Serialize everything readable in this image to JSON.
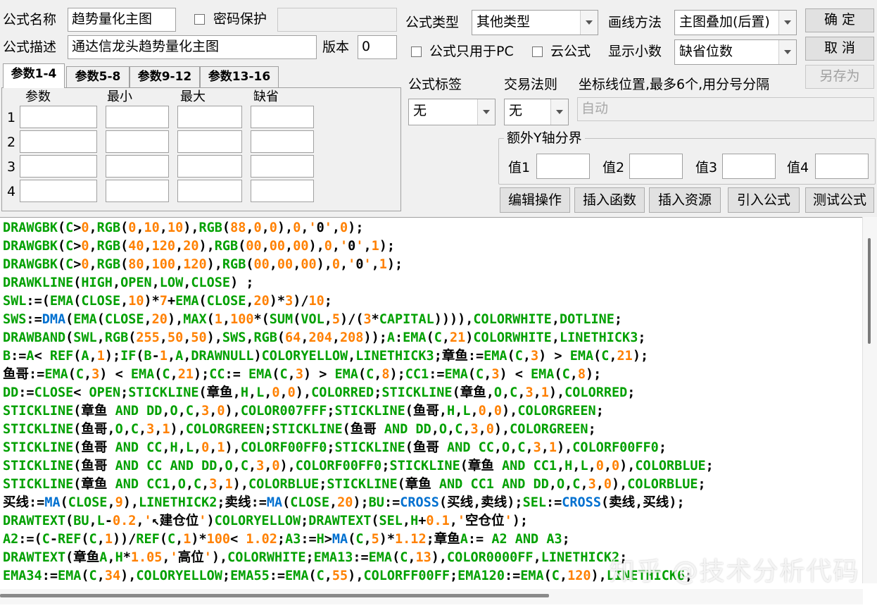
{
  "form": {
    "name_label": "公式名称",
    "name_value": "趋势量化主图",
    "password_label": "密码保护",
    "desc_label": "公式描述",
    "desc_value": "通达信龙头趋势量化主图",
    "version_label": "版本",
    "version_value": "0",
    "type_label": "公式类型",
    "type_value": "其他类型",
    "draw_method_label": "画线方法",
    "draw_method_value": "主图叠加(后置)",
    "pc_only_label": "公式只用于PC",
    "cloud_label": "云公式",
    "decimal_label": "显示小数",
    "decimal_value": "缺省位数",
    "tag_label": "公式标签",
    "tag_value": "无",
    "trade_rule_label": "交易法则",
    "trade_rule_value": "无",
    "axis_label": "坐标线位置,最多6个,用分号分隔",
    "axis_value": "自动",
    "yaxis_group_label": "额外Y轴分界",
    "val1_label": "值1",
    "val2_label": "值2",
    "val3_label": "值3",
    "val4_label": "值4"
  },
  "buttons": {
    "ok": "确  定",
    "cancel": "取  消",
    "save_as": "另存为",
    "edit_ops": "编辑操作",
    "insert_func": "插入函数",
    "insert_res": "插入资源",
    "import_formula": "引入公式",
    "test_formula": "测试公式"
  },
  "tabs": [
    "参数1-4",
    "参数5-8",
    "参数9-12",
    "参数13-16"
  ],
  "param_headers": [
    "参数",
    "最小",
    "最大",
    "缺省"
  ],
  "param_rows": [
    "1",
    "2",
    "3",
    "4"
  ],
  "code_lines": [
    "DRAWGBK(C>0,RGB(0,10,10),RGB(88,0,0),0,'0',0);",
    "DRAWGBK(C>0,RGB(40,120,20),RGB(00,00,00),0,'0',1);",
    "DRAWGBK(C>0,RGB(80,100,120),RGB(00,00,00),0,'0',1);",
    "DRAWKLINE(HIGH,OPEN,LOW,CLOSE) ;",
    "SWL:=(EMA(CLOSE,10)*7+EMA(CLOSE,20)*3)/10;",
    "SWS:=DMA(EMA(CLOSE,20),MAX(1,100*(SUM(VOL,5)/(3*CAPITAL)))),COLORWHITE,DOTLINE;",
    "DRAWBAND(SWL,RGB(255,50,50),SWS,RGB(64,204,208));A:EMA(C,21)COLORWHITE,LINETHICK3;",
    "B:=A< REF(A,1);IF(B-1,A,DRAWNULL)COLORYELLOW,LINETHICK3;章鱼:=EMA(C,3) > EMA(C,21);",
    "鱼哥:=EMA(C,3) < EMA(C,21);CC:= EMA(C,3) > EMA(C,8);CC1:=EMA(C,3) < EMA(C,8);",
    "DD:=CLOSE< OPEN;STICKLINE(章鱼,H,L,0,0),COLORRED;STICKLINE(章鱼,O,C,3,1),COLORRED;",
    "STICKLINE(章鱼 AND DD,O,C,3,0),COLOR007FFF;STICKLINE(鱼哥,H,L,0,0),COLORGREEN;",
    "STICKLINE(鱼哥,O,C,3,1),COLORGREEN;STICKLINE(鱼哥 AND DD,O,C,3,0),COLORGREEN;",
    "STICKLINE(鱼哥 AND CC,H,L,0,1),COLORF00FF0;STICKLINE(鱼哥 AND CC,O,C,3,1),COLORF00FF0;",
    "STICKLINE(鱼哥 AND CC AND DD,O,C,3,0),COLORF00FF0;STICKLINE(章鱼 AND CC1,H,L,0,0),COLORBLUE;",
    "STICKLINE(章鱼 AND CC1,O,C,3,1),COLORBLUE;STICKLINE(章鱼 AND CC1 AND DD,O,C,3,0),COLORBLUE;",
    "买线:=MA(CLOSE,9),LINETHICK2;卖线:=MA(CLOSE,20);BU:=CROSS(买线,卖线);SEL:=CROSS(卖线,买线);",
    "DRAWTEXT(BU,L-0.2,'↖建仓位')COLORYELLOW;DRAWTEXT(SEL,H+0.1,'空仓位');",
    "A2:=(C-REF(C,1))/REF(C,1)*100< 1.02;A3:=H>MA(C,5)*1.12;章鱼A:= A2 AND A3;",
    "DRAWTEXT(章鱼A,H*1.05,'高位'),COLORWHITE;EMA13:=EMA(C,13),COLOR0000FF,LINETHICK2;",
    "EMA34:=EMA(C,34),COLORYELLOW;EMA55:=EMA(C,55),COLORFF00FF;EMA120:=EMA(C,120),LINETHICK6;"
  ],
  "watermark": "知乎 @技术分析代码",
  "colors": {
    "keyword": "#00a000",
    "number": "#ff8000",
    "function": "#0070d0",
    "background": "#f0f0f0"
  }
}
